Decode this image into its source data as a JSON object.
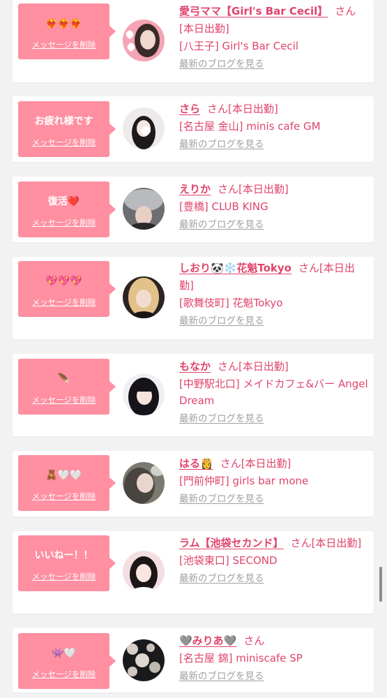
{
  "delete_label": "メッセージを削除",
  "blog_label": "最新のブログを見る",
  "suffix": "さん[本日出勤]",
  "items": [
    {
      "message": "❤️‍🔥❤️‍🔥❤️‍🔥",
      "name": "愛弓ママ【Girl's Bar Cecil】",
      "suffix": "さん[本日出勤]",
      "location": "[八王子] Girl's Bar Cecil"
    },
    {
      "message": "お疲れ様です",
      "name": "さら",
      "suffix": "さん[本日出勤]",
      "location": "[名古屋 金山] minis cafe GM"
    },
    {
      "message": "復活❤️",
      "name": "えりか",
      "suffix": "さん[本日出勤]",
      "location": "[豊橋] CLUB KING"
    },
    {
      "message": "💖💖💖",
      "name": "しおり🐼❄️花魁Tokyo",
      "suffix": "さん[本日出勤]",
      "location": "[歌舞伎町] 花魁Tokyo"
    },
    {
      "message": "🪶",
      "name": "もなか",
      "suffix": "さん[本日出勤]",
      "location": "[中野駅北口] メイドカフェ&バー Angel Dream"
    },
    {
      "message": "🧸🤍🤍",
      "name": "はる👸",
      "suffix": "さん[本日出勤]",
      "location": "[門前仲町] girls bar mone"
    },
    {
      "message": "いいねー！！",
      "name": "ラム【池袋セカンド】",
      "suffix": "さん[本日出勤]",
      "location": "[池袋東口] SECOND"
    },
    {
      "message": "👾🤍",
      "name": "🩶みりあ🩶",
      "suffix": "さん",
      "location": "[名古屋 錦] miniscafe SP"
    }
  ]
}
